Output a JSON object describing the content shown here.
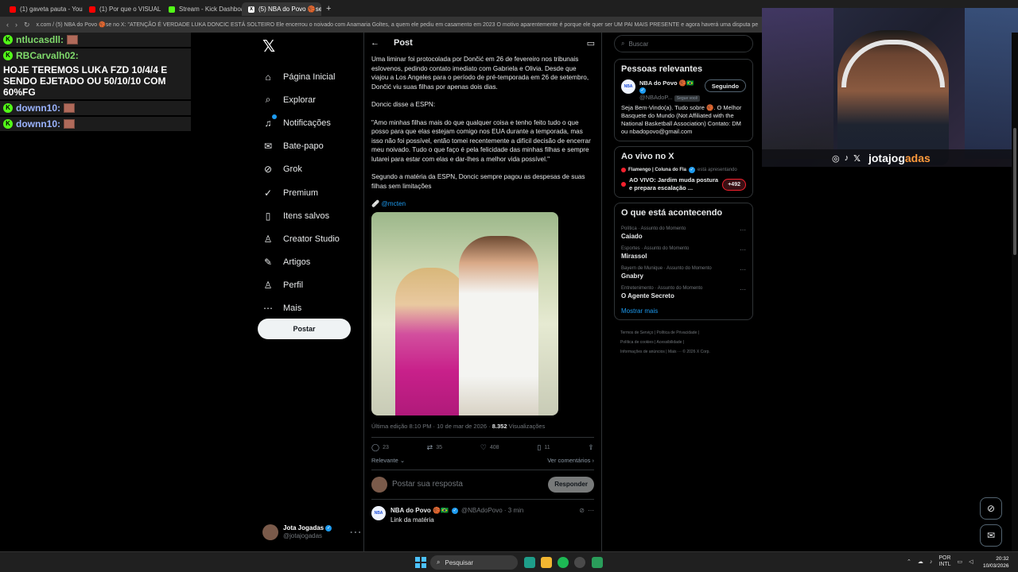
{
  "browser": {
    "tabs": [
      {
        "label": "(1) gaveta pauta - YouTube",
        "fav": "yt"
      },
      {
        "label": "(1) Por que o VISUAL do",
        "fav": "yt"
      },
      {
        "label": "Stream - Kick Dashboard",
        "fav": "kick"
      },
      {
        "label": "(5) NBA do Povo 🏀se no X",
        "fav": "x"
      }
    ],
    "new_tab": "+",
    "url": "x.com / (5) NBA do Povo 🏀se no X: \"ATENÇÃO É VERDADE LUKA DONCIC ESTÁ SOLTEIRO Ele encerrou o noivado com Anamaria Goltes, a quem ele pediu em casamento em 2023 O motivo aparentemente é porque ele quer ser UM PAI MAIS PRESENTE e agora haverá uma disputa pe"
  },
  "chat": [
    {
      "user": "ntlucasdll:",
      "message": "",
      "emote": true,
      "color": "green"
    },
    {
      "user": "RBCarvalh02:",
      "message": "HOJE TEREMOS LUKA FZD 10/4/4 E SENDO EJETADO OU 50/10/10 COM 60%FG",
      "emote": false,
      "color": "green"
    },
    {
      "user": "downn10:",
      "message": "",
      "emote": true,
      "color": "blue"
    },
    {
      "user": "downn10:",
      "message": "",
      "emote": true,
      "color": "blue"
    }
  ],
  "nav": {
    "logo": "𝕏",
    "items": [
      {
        "label": "Página Inicial",
        "icon": "home-icon",
        "glyph": "⌂"
      },
      {
        "label": "Explorar",
        "icon": "search-icon",
        "glyph": "⌕"
      },
      {
        "label": "Notificações",
        "icon": "bell-icon",
        "glyph": "♫"
      },
      {
        "label": "Bate-papo",
        "icon": "mail-icon",
        "glyph": "✉"
      },
      {
        "label": "Grok",
        "icon": "grok-icon",
        "glyph": "⊘"
      },
      {
        "label": "Premium",
        "icon": "premium-icon",
        "glyph": "✓"
      },
      {
        "label": "Itens salvos",
        "icon": "bookmark-icon",
        "glyph": "▯"
      },
      {
        "label": "Creator Studio",
        "icon": "creator-icon",
        "glyph": "♙"
      },
      {
        "label": "Artigos",
        "icon": "article-icon",
        "glyph": "✎"
      },
      {
        "label": "Perfil",
        "icon": "person-icon",
        "glyph": "♙"
      },
      {
        "label": "Mais",
        "icon": "more-icon",
        "glyph": "⋯"
      }
    ],
    "post_button": "Postar",
    "profile": {
      "name": "Jota Jogadas",
      "handle": "@jotajogadas",
      "more": "⋯"
    }
  },
  "post": {
    "header_title": "Post",
    "paragraphs": [
      "Uma liminar foi protocolada por Dončić em 26 de fevereiro nos tribunais eslovenos, pedindo contato imediato com Gabriela e Olivia. Desde que viajou a Los Angeles para o período de pré-temporada em 26 de setembro, Dončić viu suas filhas por apenas dois dias.",
      "Doncic disse a ESPN:",
      "\"Amo minhas filhas mais do que qualquer coisa e tenho feito tudo o que posso para que elas estejam comigo nos EUA durante a temporada, mas isso não foi possível, então tomei recentemente a difícil decisão de encerrar meu noivado. Tudo o que faço é pela felicidade das minhas filhas e sempre lutarei para estar com elas e dar-lhes a melhor vida possível.\"",
      "Segundo a matéria da ESPN, Doncic sempre pagou as despesas de suas filhas sem limitações"
    ],
    "credit_prefix": "🩹",
    "credit": "@mcten",
    "edit_info": "Última edição 8:10 PM · 10 de mar de 2026 · ",
    "views_count": "8.352",
    "views_label": " Visualizações",
    "actions": {
      "replies": "23",
      "reposts": "35",
      "likes": "408",
      "bookmarks": "11"
    },
    "sort_label": "Relevante ⌄",
    "view_comments": "Ver comentários ›",
    "reply_placeholder": "Postar sua resposta",
    "reply_button": "Responder",
    "comment": {
      "name": "NBA do Povo 🏀🇧🇷",
      "handle": "@NBAdoPovo · 3 min",
      "text": "Link da matéria",
      "avatar_text": "NBA"
    }
  },
  "sidebar": {
    "search_placeholder": "Buscar",
    "relevant": {
      "title": "Pessoas relevantes",
      "name": "NBA do Povo 🏀🇧🇷",
      "handle": "@NBAdoP...",
      "follows_you": "Segue você",
      "button": "Seguindo",
      "bio": "Seja Bem-Vindo(a). Tudo sobre 🏀. O Melhor Basquete do Mundo (Not Affiliated with the National Basketball Association) Contato: DM ou nbadopovo@gmail.com"
    },
    "live": {
      "title": "Ao vivo no X",
      "host": "Flamengo | Coluna do Fla",
      "host_suffix": "está apresentando",
      "event": "AO VIVO: Jardim muda postura e prepara escalação ...",
      "count": "+492"
    },
    "trends": {
      "title": "O que está acontecendo",
      "items": [
        {
          "category": "Política · Assunto do Momento",
          "name": "Caiado"
        },
        {
          "category": "Esportes · Assunto do Momento",
          "name": "Mirassol"
        },
        {
          "category": "Bayern de Munique · Assunto do Momento",
          "name": "Gnabry"
        },
        {
          "category": "Entretenimento · Assunto do Momento",
          "name": "O Agente Secreto"
        }
      ],
      "show_more": "Mostrar mais"
    },
    "footer": [
      "Termos de Serviço |  Política de Privacidade |",
      "Política de cookies |  Acessibilidade |",
      "Informações de anúncios |  Mais ··· © 2026 X Corp."
    ]
  },
  "webcam": {
    "handle_main": "jotajog",
    "handle_accent": "adas",
    "icons": [
      "◎",
      "♪",
      "𝕏"
    ]
  },
  "taskbar": {
    "search": "Pesquisar",
    "lang_top": "POR",
    "lang_bottom": "INTL",
    "time": "20:32",
    "date": "10/03/2026"
  },
  "colors": {
    "accent": "#1d9bf0",
    "kick_green": "#53fc18",
    "live_red": "#f4212e"
  }
}
